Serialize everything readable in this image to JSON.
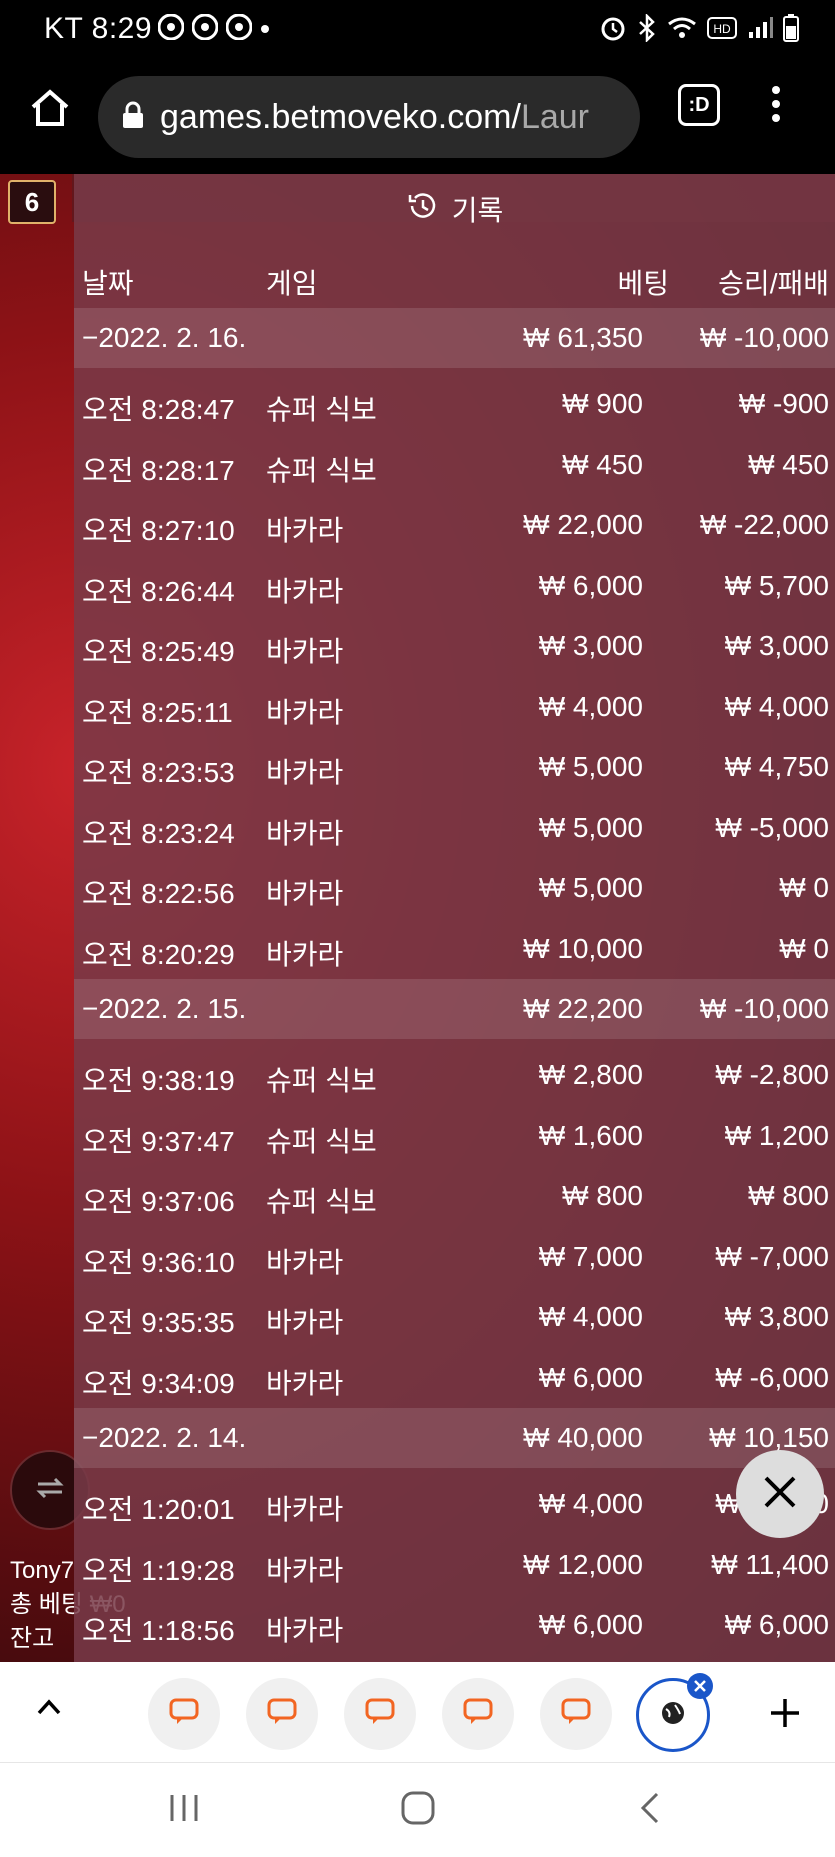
{
  "status_bar": {
    "carrier_time": "KT 8:29",
    "left_icons": [
      "chrome-icon",
      "chrome-icon",
      "chrome-icon",
      "dot-icon"
    ],
    "right_icons": [
      "alarm-icon",
      "bluetooth-icon",
      "wifi-icon",
      "hd-icon",
      "signal-icon",
      "battery-icon"
    ]
  },
  "browser": {
    "url_main": "games.betmoveko.com/",
    "url_rest": "Laur",
    "tab_switcher_label": ":D"
  },
  "game": {
    "badge_number": "6",
    "player_name": "Tony7",
    "total_bet_label": "총 베팅",
    "total_bet_value": "₩0",
    "balance_label": "잔고"
  },
  "history": {
    "title": "기록",
    "columns": {
      "date": "날짜",
      "game": "게임",
      "bet": "베팅",
      "result": "승리/패배"
    },
    "groups": [
      {
        "date": "−2022. 2. 16.",
        "total_bet": "₩ 61,350",
        "total_result": "₩ -10,000",
        "items": [
          {
            "time": "오전 8:28:47",
            "game": "슈퍼 식보",
            "bet": "₩ 900",
            "result": "₩ -900"
          },
          {
            "time": "오전 8:28:17",
            "game": "슈퍼 식보",
            "bet": "₩ 450",
            "result": "₩ 450"
          },
          {
            "time": "오전 8:27:10",
            "game": "바카라",
            "bet": "₩ 22,000",
            "result": "₩ -22,000"
          },
          {
            "time": "오전 8:26:44",
            "game": "바카라",
            "bet": "₩ 6,000",
            "result": "₩ 5,700"
          },
          {
            "time": "오전 8:25:49",
            "game": "바카라",
            "bet": "₩ 3,000",
            "result": "₩ 3,000"
          },
          {
            "time": "오전 8:25:11",
            "game": "바카라",
            "bet": "₩ 4,000",
            "result": "₩ 4,000"
          },
          {
            "time": "오전 8:23:53",
            "game": "바카라",
            "bet": "₩ 5,000",
            "result": "₩ 4,750"
          },
          {
            "time": "오전 8:23:24",
            "game": "바카라",
            "bet": "₩ 5,000",
            "result": "₩ -5,000"
          },
          {
            "time": "오전 8:22:56",
            "game": "바카라",
            "bet": "₩ 5,000",
            "result": "₩ 0"
          },
          {
            "time": "오전 8:20:29",
            "game": "바카라",
            "bet": "₩ 10,000",
            "result": "₩ 0"
          }
        ]
      },
      {
        "date": "−2022. 2. 15.",
        "total_bet": "₩ 22,200",
        "total_result": "₩ -10,000",
        "items": [
          {
            "time": "오전 9:38:19",
            "game": "슈퍼 식보",
            "bet": "₩ 2,800",
            "result": "₩ -2,800"
          },
          {
            "time": "오전 9:37:47",
            "game": "슈퍼 식보",
            "bet": "₩ 1,600",
            "result": "₩ 1,200"
          },
          {
            "time": "오전 9:37:06",
            "game": "슈퍼 식보",
            "bet": "₩ 800",
            "result": "₩ 800"
          },
          {
            "time": "오전 9:36:10",
            "game": "바카라",
            "bet": "₩ 7,000",
            "result": "₩ -7,000"
          },
          {
            "time": "오전 9:35:35",
            "game": "바카라",
            "bet": "₩ 4,000",
            "result": "₩ 3,800"
          },
          {
            "time": "오전 9:34:09",
            "game": "바카라",
            "bet": "₩ 6,000",
            "result": "₩ -6,000"
          }
        ]
      },
      {
        "date": "−2022. 2. 14.",
        "total_bet": "₩ 40,000",
        "total_result": "₩ 10,150",
        "items": [
          {
            "time": "오전 1:20:01",
            "game": "바카라",
            "bet": "₩ 4,000",
            "result": "₩ -4,000"
          },
          {
            "time": "오전 1:19:28",
            "game": "바카라",
            "bet": "₩ 12,000",
            "result": "₩ 11,400"
          },
          {
            "time": "오전 1:18:56",
            "game": "바카라",
            "bet": "₩ 6,000",
            "result": "₩ 6,000"
          }
        ]
      }
    ]
  },
  "bottom_tabs": {
    "tab_icons": [
      "chat-icon",
      "chat-icon",
      "chat-icon",
      "chat-icon",
      "chat-icon",
      "chat-icon"
    ]
  },
  "colors": {
    "panel": "#7a3a48",
    "accent_orange": "#f26522",
    "active_tab_border": "#1a56c9"
  }
}
